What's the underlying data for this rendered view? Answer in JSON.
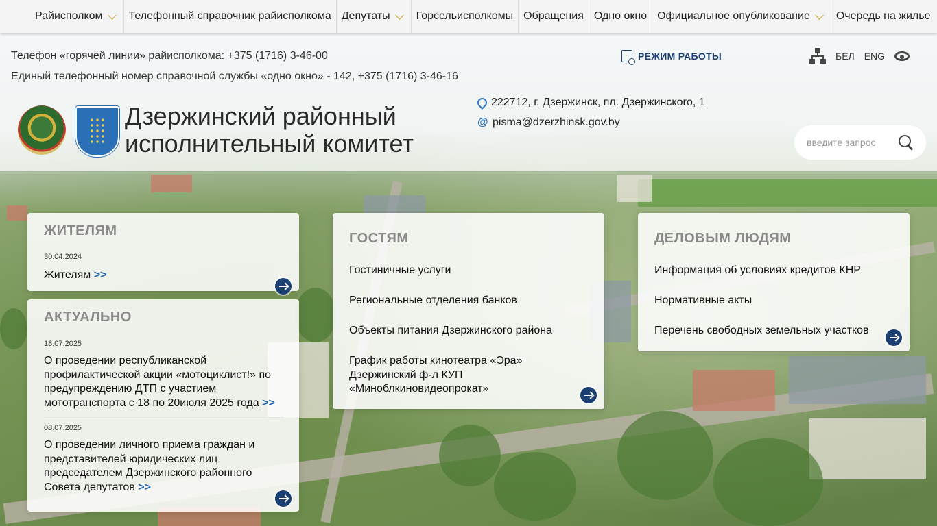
{
  "nav": {
    "items": [
      {
        "label": "Райисполком",
        "dropdown": true
      },
      {
        "label": "Телефонный справочник райисполкома",
        "dropdown": false
      },
      {
        "label": "Депутаты",
        "dropdown": true
      },
      {
        "label": "Горсельисполкомы",
        "dropdown": false
      },
      {
        "label": "Обращения",
        "dropdown": false
      },
      {
        "label": "Одно окно",
        "dropdown": false
      },
      {
        "label": "Официальное опубликование",
        "dropdown": true
      },
      {
        "label": "Очередь на жилье",
        "dropdown": false
      }
    ]
  },
  "header": {
    "hotline": "Телефон «горячей линии» райисполкома: +375 (1716) 3-46-00",
    "one_window": "Единый телефонный номер справочной службы «одно окно» - 142, +375 (1716) 3-46-16",
    "work_hours": "РЕЖИМ РАБОТЫ",
    "lang_bel": "БЕЛ",
    "lang_eng": "ENG",
    "title_line1": "Дзержинский районный",
    "title_line2": "исполнительный комитет",
    "address": "222712, г. Дзержинск, пл. Дзержинского, 1",
    "email": "pisma@dzerzhinsk.gov.by",
    "search_placeholder": "введите запрос"
  },
  "residents": {
    "title": "ЖИТЕЛЯМ",
    "date": "30.04.2024",
    "link": "Жителям",
    "more": ">>"
  },
  "actual": {
    "title": "АКТУАЛЬНО",
    "items": [
      {
        "date": "18.07.2025",
        "text": "О проведении республиканской профилактической акции «мотоциклист!» по предупреждению ДТП с участием мототранспорта с 18 по 20июля 2025 года",
        "more": ">>"
      },
      {
        "date": "08.07.2025",
        "text": "О проведении личного приема граждан и представителей юридических лиц председателем Дзержинского районного Совета депутатов",
        "more": ">>"
      }
    ]
  },
  "guests": {
    "title": "ГОСТЯМ",
    "items": [
      "Гостиничные услуги",
      "Региональные отделения банков",
      "Объекты питания Дзержинского района",
      "График работы кинотеатра «Эра» Дзержинский ф-л КУП «Миноблкиновидеопрокат»"
    ]
  },
  "business": {
    "title": "ДЕЛОВЫМ ЛЮДЯМ",
    "items": [
      "Информация об условиях кредитов КНР",
      "Нормативные акты",
      "Перечень свободных земельных участков"
    ]
  },
  "colors": {
    "accent": "#1c3f73",
    "link_more": "#1c5fa8",
    "chevron": "#c9a227",
    "icon_blue": "#2f78c4"
  }
}
